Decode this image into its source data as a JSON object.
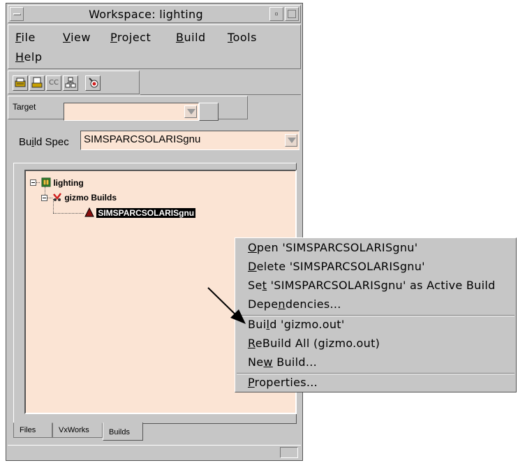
{
  "window": {
    "title": "Workspace: lighting"
  },
  "menubar": {
    "items": [
      {
        "pre": "",
        "u": "F",
        "post": "ile"
      },
      {
        "pre": "",
        "u": "V",
        "post": "iew"
      },
      {
        "pre": "",
        "u": "P",
        "post": "roject"
      },
      {
        "pre": "",
        "u": "B",
        "post": "uild"
      },
      {
        "pre": "",
        "u": "T",
        "post": "ools"
      },
      {
        "pre": "",
        "u": "H",
        "post": "elp"
      }
    ]
  },
  "toolbar": {
    "icons": [
      "build-workspace-icon",
      "build-project-icon",
      "compile-cc-icon",
      "dependencies-icon",
      "download-icon"
    ],
    "cc_label": "CC"
  },
  "target": {
    "label": "Target",
    "value": ""
  },
  "build_spec": {
    "label_pre": "Bu",
    "label_u": "i",
    "label_post": "ld Spec",
    "value": "SIMSPARCSOLARISgnu"
  },
  "tree": {
    "root": "lighting",
    "child": "gizmo Builds",
    "leaf": "SIMSPARCSOLARISgnu"
  },
  "tabs": [
    "Files",
    "VxWorks",
    "Builds"
  ],
  "context_menu": {
    "items": [
      {
        "pre": "",
        "u": "O",
        "post": "pen 'SIMSPARCSOLARISgnu'"
      },
      {
        "pre": "",
        "u": "D",
        "post": "elete 'SIMSPARCSOLARISgnu'"
      },
      {
        "pre": "Se",
        "u": "t",
        "post": " 'SIMSPARCSOLARISgnu' as Active Build"
      },
      {
        "pre": "Depe",
        "u": "n",
        "post": "dencies..."
      },
      {
        "pre": "Bui",
        "u": "l",
        "post": "d 'gizmo.out'"
      },
      {
        "pre": "",
        "u": "R",
        "post": "eBuild All (gizmo.out)"
      },
      {
        "pre": "Ne",
        "u": "w",
        "post": " Build..."
      },
      {
        "pre": "",
        "u": "P",
        "post": "roperties..."
      }
    ]
  },
  "colors": {
    "chrome": "#c6c6c6",
    "field_bg": "#fbe4d4"
  }
}
